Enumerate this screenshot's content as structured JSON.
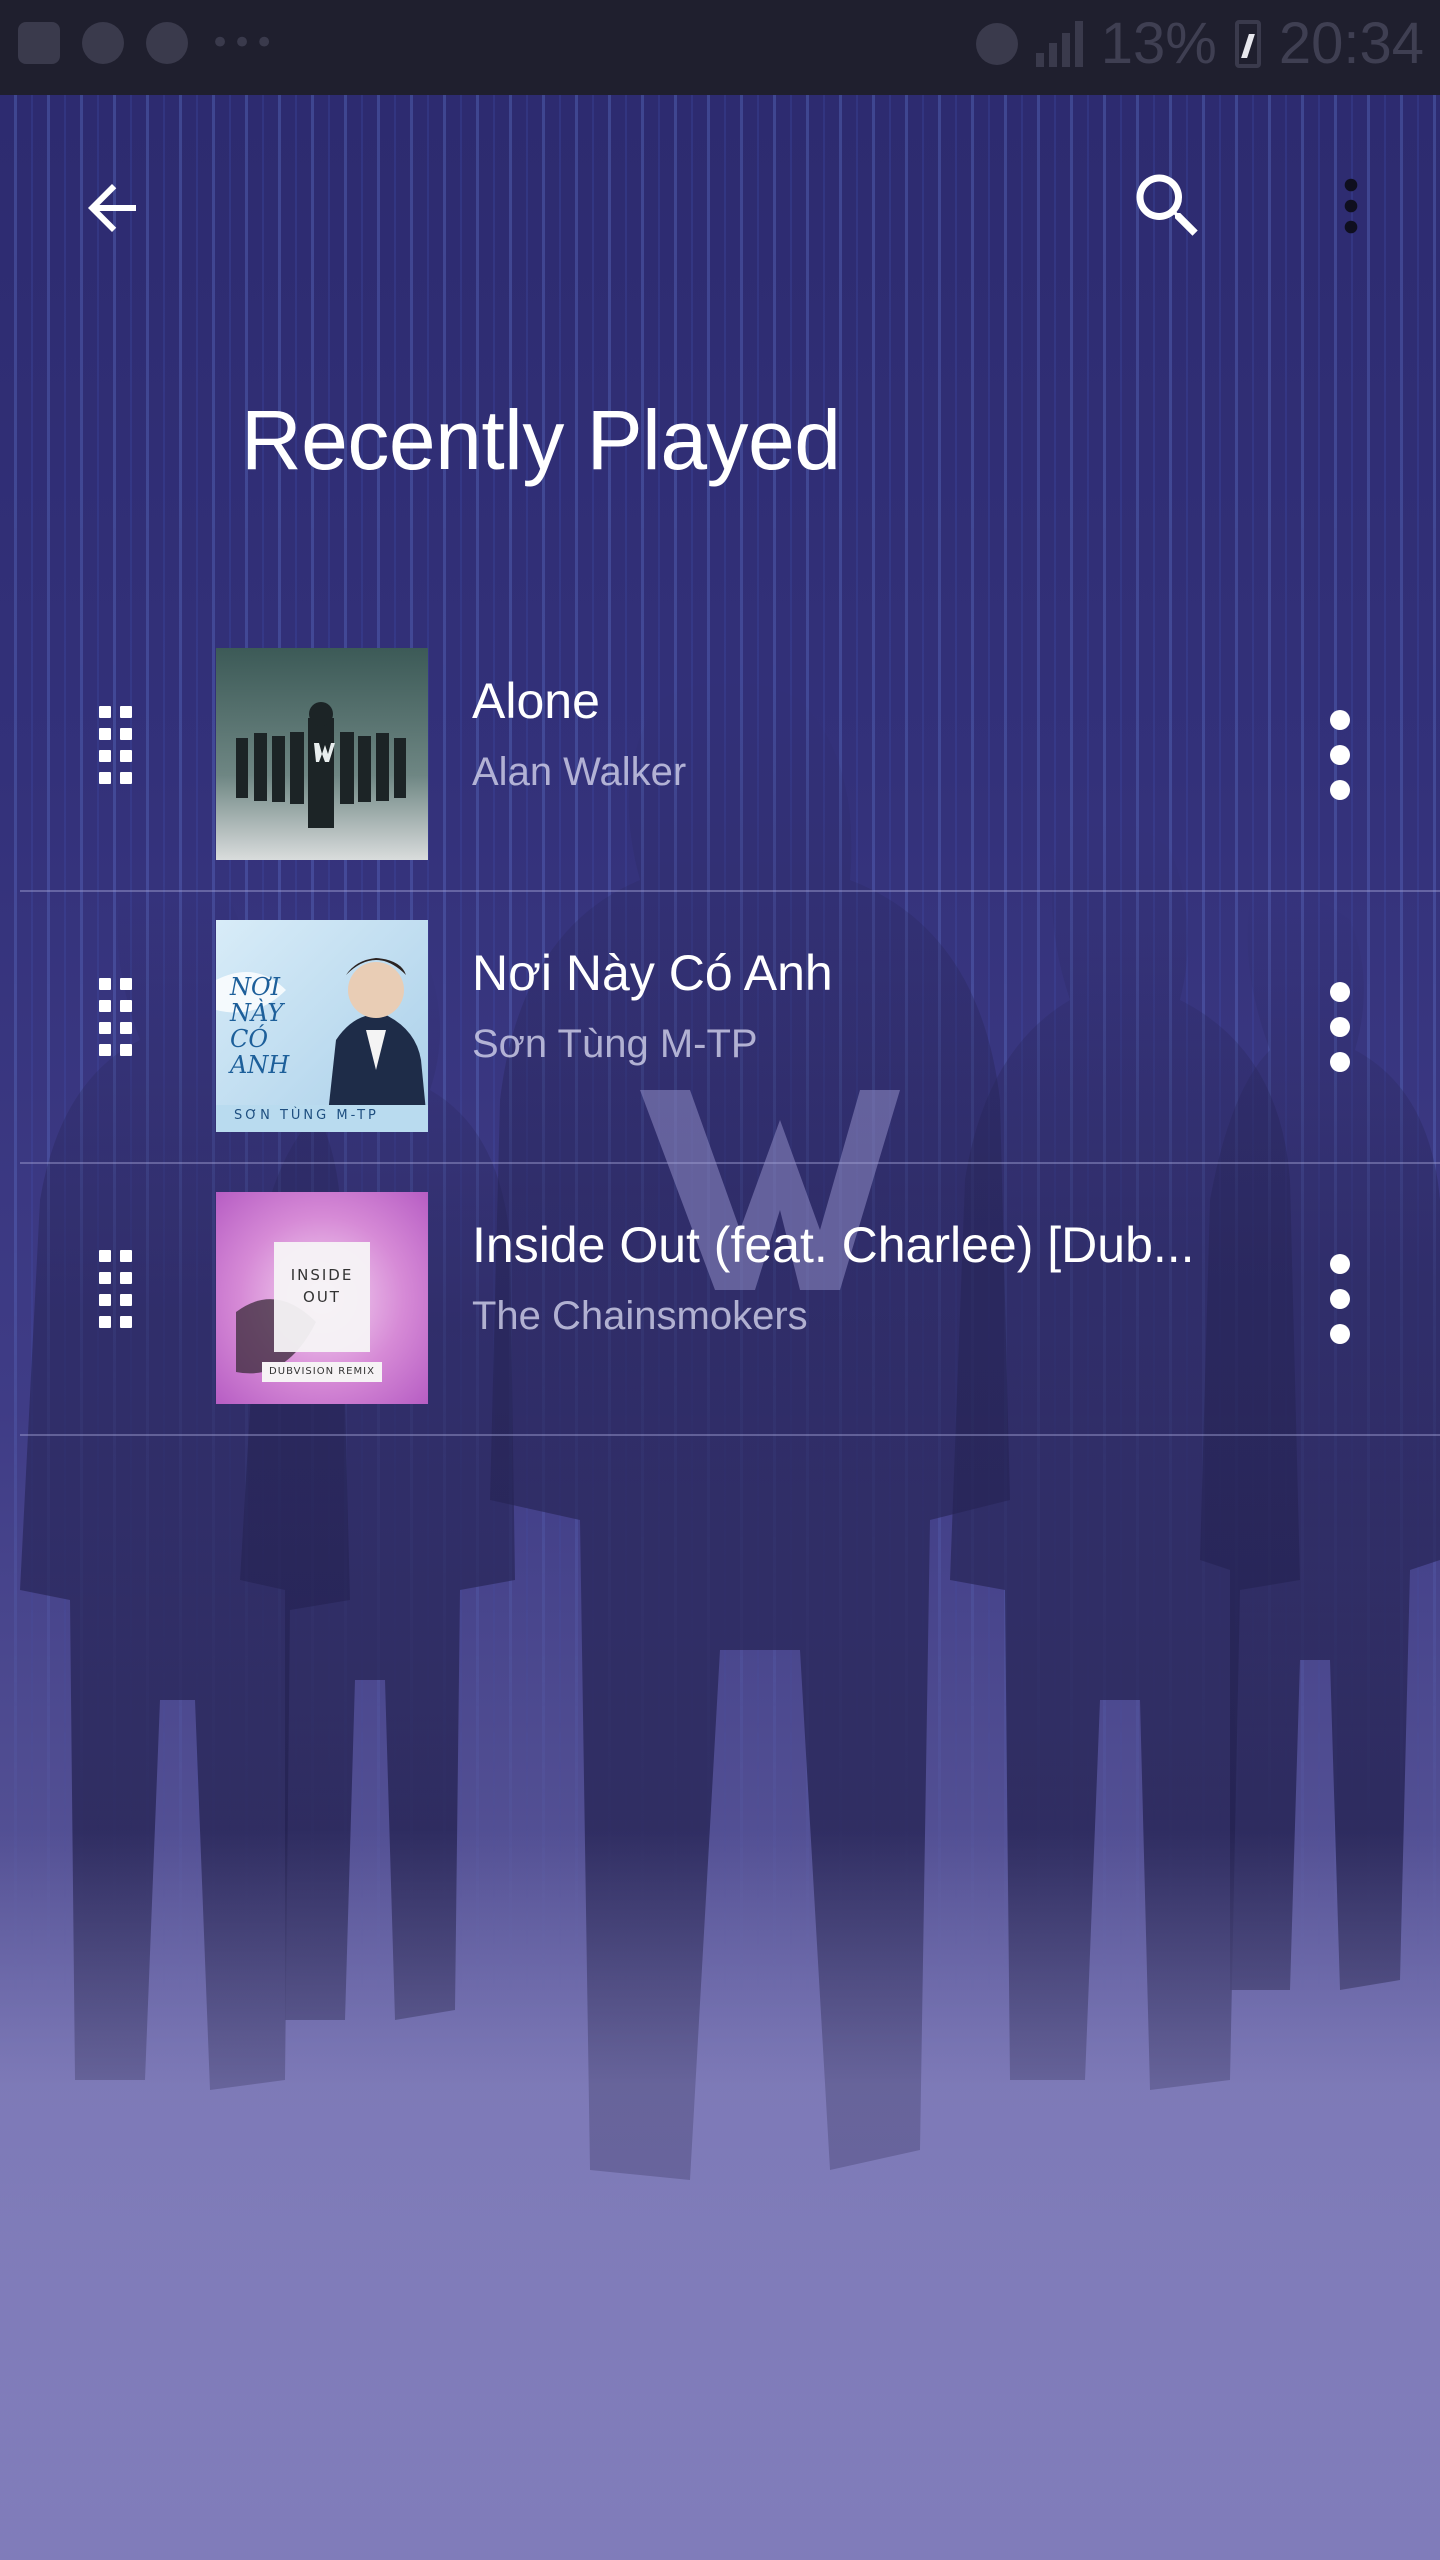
{
  "status_bar": {
    "battery_percent": "13%",
    "time": "20:34",
    "icons": [
      "gallery-icon",
      "messenger-icon",
      "headphones-icon",
      "more-notifications-icon",
      "alarm-icon",
      "data-icon",
      "signal-icon",
      "battery-charging-icon"
    ]
  },
  "toolbar": {
    "back_icon": "arrow-left-icon",
    "search_icon": "search-icon",
    "more_icon": "more-vert-icon"
  },
  "page": {
    "title": "Recently Played"
  },
  "tracks": [
    {
      "title": "Alone",
      "artist": "Alan Walker",
      "art_icon": "album-art-alone"
    },
    {
      "title": "Nơi Này Có Anh",
      "artist": "Sơn Tùng M-TP",
      "art_icon": "album-art-noi-nay-co-anh"
    },
    {
      "title": "Inside Out (feat. Charlee) [Dub...",
      "artist": "The Chainsmokers",
      "art_icon": "album-art-inside-out"
    }
  ],
  "album_art_text": {
    "noi_nay_co_anh_title": "NƠI NÀY CÓ ANH",
    "noi_nay_co_anh_artist": "SƠN TÙNG M-TP",
    "inside_out_title": "INSIDE OUT",
    "inside_out_subtitle": "DUBVISION REMIX"
  },
  "colors": {
    "background_top": "#2c2a6e",
    "background_bottom": "#7a77b0",
    "text_primary": "#ffffff",
    "text_secondary": "#d2d2eb",
    "status_bar": "#1f1f2e"
  }
}
